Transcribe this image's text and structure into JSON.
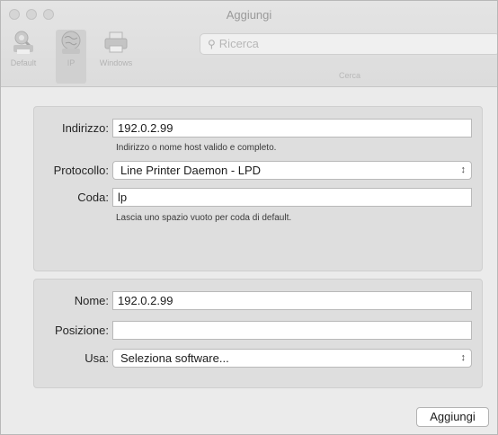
{
  "window": {
    "title": "Aggiungi"
  },
  "toolbar": {
    "items": [
      {
        "label": "Default",
        "icon": "default-printer-icon"
      },
      {
        "label": "IP",
        "icon": "globe-icon",
        "selected": true
      },
      {
        "label": "Windows",
        "icon": "windows-printer-icon"
      }
    ],
    "search": {
      "placeholder": "Ricerca",
      "label": "Cerca"
    }
  },
  "form": {
    "address": {
      "label": "Indirizzo:",
      "value": "192.0.2.99",
      "hint": "Indirizzo o nome host valido e completo."
    },
    "protocol": {
      "label": "Protocollo:",
      "value": "Line Printer Daemon - LPD"
    },
    "queue": {
      "label": "Coda:",
      "value": "lp",
      "hint": "Lascia uno spazio vuoto per coda di default."
    },
    "name": {
      "label": "Nome:",
      "value": "192.0.2.99"
    },
    "location": {
      "label": "Posizione:",
      "value": ""
    },
    "use": {
      "label": "Usa:",
      "value": "Seleziona software..."
    }
  },
  "actions": {
    "add_label": "Aggiungi"
  },
  "colors": {
    "window_bg": "#ebebeb",
    "panel_bg": "#dedede",
    "field_bg": "#ffffff"
  }
}
